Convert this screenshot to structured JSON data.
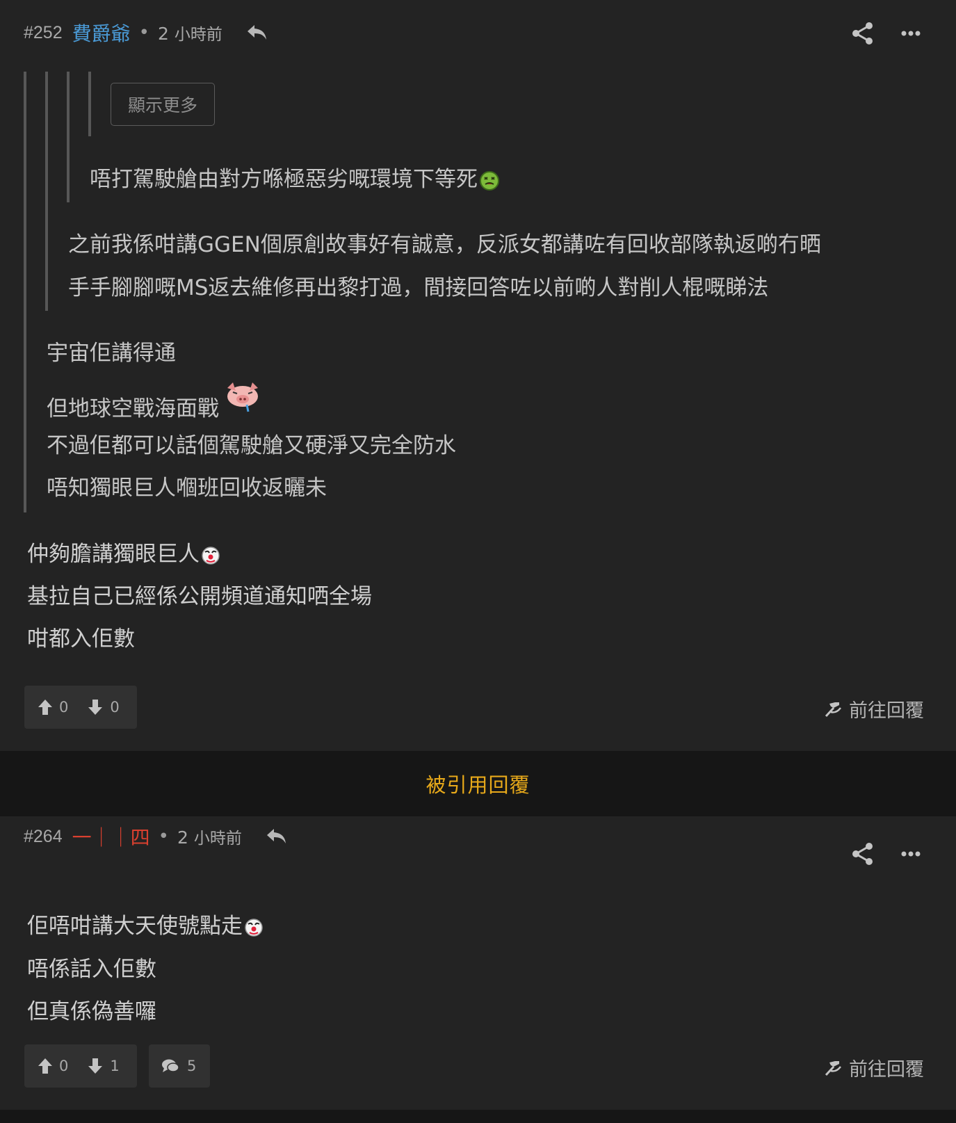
{
  "colors": {
    "username_blue": "#4a9ad6",
    "username_red": "#d9402f",
    "accent_gold": "#e8a91a"
  },
  "post1": {
    "number": "#252",
    "username": "費爵爺",
    "separator": "•",
    "time_num": "2",
    "time_unit": "小時前",
    "show_more_label": "顯示更多",
    "quote_level3": "唔打駕駛艙由對方喺極惡劣嘅環境下等死",
    "quote_level2": [
      "之前我係咁講GGEN個原創故事好有誠意，反派女都講咗有回收部隊執返啲冇晒",
      "手手腳腳嘅MS返去維修再出黎打過，間接回答咗以前啲人對削人棍嘅睇法"
    ],
    "quote_level1": [
      "宇宙佢講得通",
      "但地球空戰海面戰",
      "不過佢都可以話個駕駛艙又硬淨又完全防水",
      "唔知獨眼巨人嗰班回收返曬未"
    ],
    "body": [
      "仲夠膽講獨眼巨人",
      "基拉自己已經係公開頻道通知哂全場",
      "咁都入佢數"
    ],
    "upvotes": "0",
    "downvotes": "0",
    "goto_reply_label": "前往回覆"
  },
  "quoted_replies_label": "被引用回覆",
  "post2": {
    "number": "#264",
    "username": "一｜｜四",
    "separator": "•",
    "time_num": "2",
    "time_unit": "小時前",
    "body": [
      "佢唔咁講大天使號點走",
      "唔係話入佢數",
      "但真係偽善囉"
    ],
    "upvotes": "0",
    "downvotes": "1",
    "comments": "5",
    "goto_reply_label": "前往回覆"
  }
}
